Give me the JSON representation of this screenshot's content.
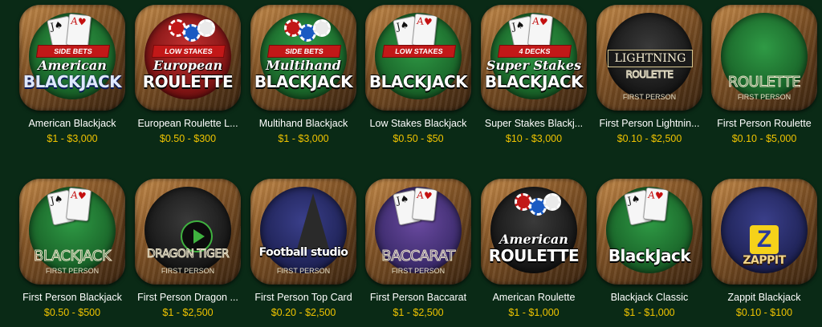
{
  "games": [
    {
      "name": "American Blackjack",
      "range": "$1 - $3,000",
      "banner": "SIDE BETS",
      "sub": "American",
      "logo": "BLACKJACK",
      "style": "green",
      "logo_color": "blue",
      "icon": "blackjack-cards-icon"
    },
    {
      "name": "European Roulette L...",
      "range": "$0.50 - $300",
      "banner": "LOW STAKES",
      "sub": "European",
      "logo": "ROULETTE",
      "style": "red",
      "logo_color": "white",
      "icon": "roulette-wheel-icon"
    },
    {
      "name": "Multihand Blackjack",
      "range": "$1 - $3,000",
      "banner": "SIDE BETS",
      "sub": "Multihand",
      "logo": "BLACKJACK",
      "style": "green",
      "logo_color": "white",
      "icon": "chips-icon"
    },
    {
      "name": "Low Stakes Blackjack",
      "range": "$0.50 - $50",
      "banner": "LOW STAKES",
      "sub": "",
      "logo": "BLACKJACK",
      "style": "green",
      "logo_color": "white",
      "icon": "blackjack-cards-icon"
    },
    {
      "name": "Super Stakes Blackj...",
      "range": "$10 - $3,000",
      "banner": "4 DECKS",
      "sub": "Super Stakes",
      "logo": "BLACKJACK",
      "style": "green",
      "logo_color": "white",
      "icon": "blackjack-cards-icon"
    },
    {
      "name": "First Person Lightnin...",
      "range": "$0.10 - $2,500",
      "banner": "",
      "sub": "",
      "logo": "LIGHTNING",
      "logo2": "ROULETTE",
      "fp": "FIRST PERSON",
      "style": "dark",
      "logo_color": "gold",
      "icon": "lightning-roulette-icon"
    },
    {
      "name": "First Person Roulette",
      "range": "$0.10 - $5,000",
      "banner": "",
      "sub": "",
      "logo": "ROULETTE",
      "fp": "FIRST PERSON",
      "style": "green",
      "logo_color": "outline",
      "icon": "roulette-table-icon"
    },
    {
      "name": "First Person Blackjack",
      "range": "$0.50 - $500",
      "banner": "",
      "sub": "",
      "logo": "BLACKJACK",
      "fp": "FIRST PERSON",
      "style": "green",
      "logo_color": "outline",
      "icon": "blackjack-table-icon"
    },
    {
      "name": "First Person Dragon ...",
      "range": "$1 - $2,500",
      "banner": "",
      "sub": "",
      "logo": "DRAGON TIGER",
      "fp": "FIRST PERSON",
      "style": "dark",
      "logo_color": "outline",
      "icon": "play-icon"
    },
    {
      "name": "First Person Top Card",
      "range": "$0.20 - $2,500",
      "banner": "",
      "sub": "",
      "logo": "Football studio",
      "fp": "FIRST PERSON",
      "style": "blue",
      "logo_color": "white",
      "icon": "football-studio-icon"
    },
    {
      "name": "First Person Baccarat",
      "range": "$1 - $2,500",
      "banner": "",
      "sub": "",
      "logo": "BACCARAT",
      "fp": "FIRST PERSON",
      "style": "purple",
      "logo_color": "outline",
      "icon": "baccarat-cards-icon"
    },
    {
      "name": "American Roulette",
      "range": "$1 - $1,000",
      "banner": "",
      "sub": "American",
      "logo": "ROULETTE",
      "style": "dark",
      "logo_color": "white",
      "icon": "roulette-wheel-icon"
    },
    {
      "name": "Blackjack Classic",
      "range": "$1 - $1,000",
      "banner": "",
      "sub": "",
      "logo": "BlackJack",
      "style": "green",
      "logo_color": "white",
      "icon": "blackjack-cards-icon"
    },
    {
      "name": "Zappit Blackjack",
      "range": "$0.10 - $100",
      "banner": "",
      "sub": "",
      "logo": "ZAPPIT",
      "logo2": "Z",
      "style": "blue",
      "logo_color": "gold",
      "icon": "zappit-icon"
    }
  ]
}
